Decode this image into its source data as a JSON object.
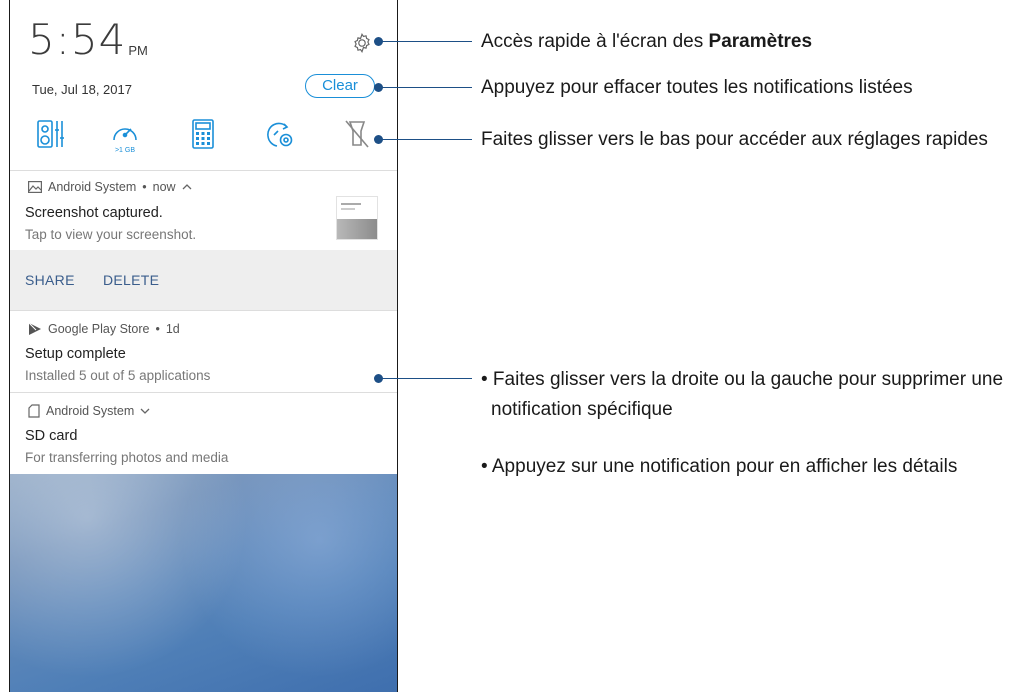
{
  "status": {
    "time": "5:54",
    "ampm": "PM",
    "date": "Tue, Jul 18, 2017"
  },
  "header": {
    "clear_label": "Clear"
  },
  "quick_settings": {
    "icons": [
      "equalizer-icon",
      "data-speed-icon",
      "calculator-icon",
      "clean-boost-icon",
      "flashlight-off-icon"
    ],
    "data_badge": ">1 GB"
  },
  "notifications": [
    {
      "app": "Android System",
      "meta": "now",
      "title": "Screenshot captured.",
      "text": "Tap to view your screenshot.",
      "actions": [
        "SHARE",
        "DELETE"
      ]
    },
    {
      "app": "Google Play Store",
      "meta": "1d",
      "title": "Setup complete",
      "text": "Installed 5 out of 5 applications"
    },
    {
      "app": "Android System",
      "title": "SD card",
      "text": "For transferring photos and media"
    }
  ],
  "callouts": {
    "settings_prefix": "Accès rapide à l'écran des ",
    "settings_bold": "Paramètres",
    "clear": "Appuyez pour effacer toutes les notifications listées",
    "quick": "Faites glisser vers le bas pour accéder aux réglages rapides",
    "swipe_line1": "• Faites glisser vers la droite ou la gauche pour supprimer une",
    "swipe_line2": "notification spécifique",
    "tap": "• Appuyez sur une notification pour en afficher les détails"
  },
  "colors": {
    "accent": "#1a8fd8",
    "callout": "#1d4f86",
    "action_text": "#3a5d8c"
  }
}
